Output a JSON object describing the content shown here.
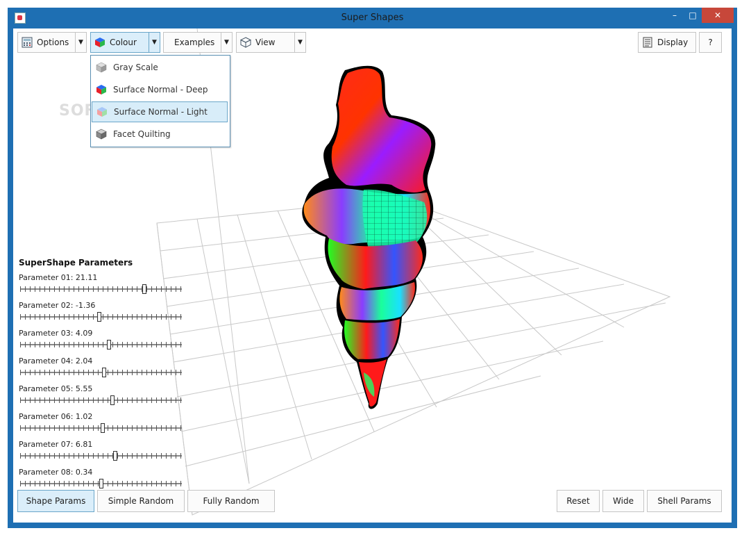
{
  "window": {
    "title": "Super Shapes",
    "controls": {
      "minimize": "–",
      "maximize": "□",
      "close": "✕"
    }
  },
  "toolbar": {
    "options": {
      "label": "Options",
      "icon": "calculator-icon"
    },
    "colour": {
      "label": "Colour",
      "icon": "colour-cube-icon"
    },
    "examples": {
      "label": "Examples"
    },
    "view": {
      "label": "View",
      "icon": "wireframe-cube-icon"
    },
    "display": {
      "label": "Display",
      "icon": "document-icon"
    },
    "help": {
      "label": "?"
    },
    "dropdown_arrow": "▼"
  },
  "colour_menu": {
    "items": [
      {
        "label": "Gray Scale",
        "icon": "gray-cube-icon"
      },
      {
        "label": "Surface Normal - Deep",
        "icon": "deep-colour-cube-icon"
      },
      {
        "label": "Surface Normal - Light",
        "icon": "light-colour-cube-icon",
        "highlighted": true
      },
      {
        "label": "Facet Quilting",
        "icon": "quilt-cube-icon"
      }
    ]
  },
  "watermark": "SOFTPEDIA",
  "parameters": {
    "title": "SuperShape Parameters",
    "items": [
      {
        "label": "Parameter 01: 21.11",
        "position": 0.77
      },
      {
        "label": "Parameter 02: -1.36",
        "position": 0.49
      },
      {
        "label": "Parameter 03: 4.09",
        "position": 0.55
      },
      {
        "label": "Parameter 04: 2.04",
        "position": 0.52
      },
      {
        "label": "Parameter 05: 5.55",
        "position": 0.57
      },
      {
        "label": "Parameter 06: 1.02",
        "position": 0.51
      },
      {
        "label": "Parameter 07: 6.81",
        "position": 0.59
      },
      {
        "label": "Parameter 08: 0.34",
        "position": 0.5
      }
    ]
  },
  "bottom_buttons": {
    "shape_params": "Shape Params",
    "simple_random": "Simple Random",
    "fully_random": "Fully Random",
    "reset": "Reset",
    "wide": "Wide",
    "shell_params": "Shell Params"
  },
  "colors": {
    "window_border": "#1e6fb3",
    "close_button": "#c7473a",
    "active_button": "#dbeefa",
    "active_border": "#6aa6c9"
  }
}
